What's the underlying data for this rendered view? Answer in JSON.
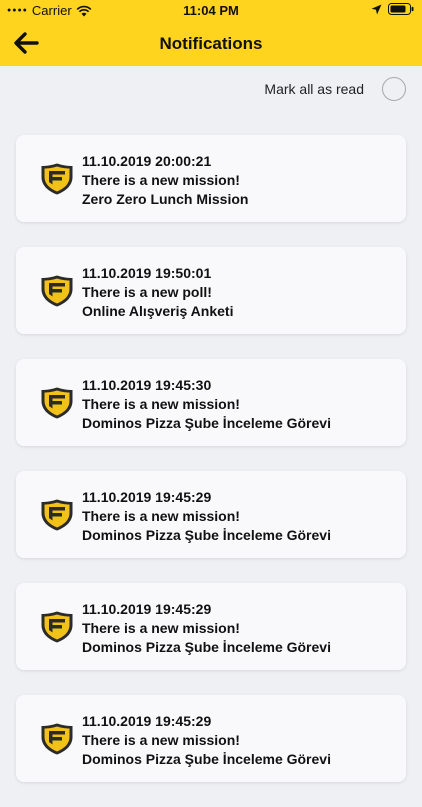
{
  "status_bar": {
    "carrier": "Carrier",
    "time": "11:04 PM"
  },
  "header": {
    "title": "Notifications"
  },
  "controls": {
    "mark_all_label": "Mark all as read"
  },
  "notifications": [
    {
      "datetime": "11.10.2019 20:00:21",
      "type": "There is a new mission!",
      "name": "Zero Zero Lunch Mission"
    },
    {
      "datetime": "11.10.2019 19:50:01",
      "type": "There is a new poll!",
      "name": "Online Alışveriş Anketi"
    },
    {
      "datetime": "11.10.2019 19:45:30",
      "type": "There is a new mission!",
      "name": "Dominos Pizza Şube İnceleme Görevi"
    },
    {
      "datetime": "11.10.2019 19:45:29",
      "type": "There is a new mission!",
      "name": "Dominos Pizza Şube İnceleme Görevi"
    },
    {
      "datetime": "11.10.2019 19:45:29",
      "type": "There is a new mission!",
      "name": "Dominos Pizza Şube İnceleme Görevi"
    },
    {
      "datetime": "11.10.2019 19:45:29",
      "type": "There is a new mission!",
      "name": "Dominos Pizza Şube İnceleme Görevi"
    }
  ],
  "icons": {
    "back": "arrow-left-icon",
    "notification": "shield-logo-icon",
    "wifi": "wifi-icon",
    "location": "location-arrow-icon",
    "battery": "battery-icon"
  },
  "colors": {
    "accent": "#ffd41f",
    "background": "#eef0f4",
    "card": "#f9f9fb"
  }
}
